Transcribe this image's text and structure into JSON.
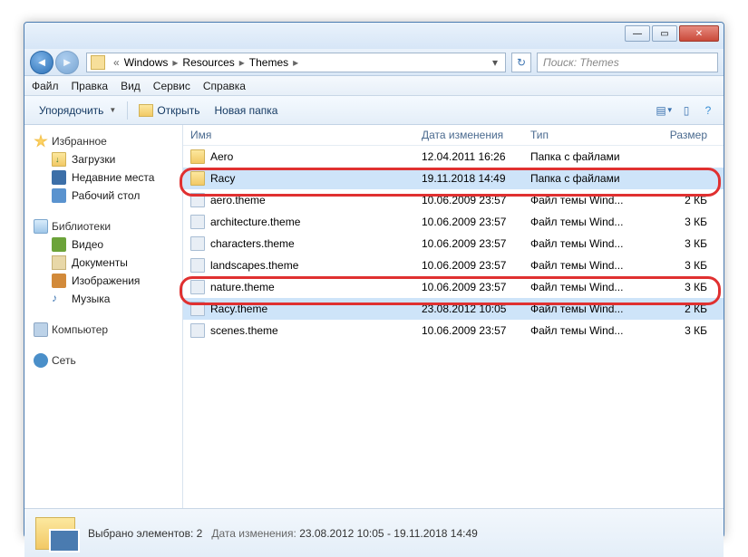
{
  "breadcrumb": [
    "Windows",
    "Resources",
    "Themes"
  ],
  "search_placeholder": "Поиск: Themes",
  "menu": {
    "file": "Файл",
    "edit": "Правка",
    "view": "Вид",
    "tools": "Сервис",
    "help": "Справка"
  },
  "toolbar": {
    "organize": "Упорядочить",
    "open": "Открыть",
    "newfolder": "Новая папка"
  },
  "sidebar": {
    "fav": {
      "head": "Избранное",
      "items": [
        "Загрузки",
        "Недавние места",
        "Рабочий стол"
      ]
    },
    "lib": {
      "head": "Библиотеки",
      "items": [
        "Видео",
        "Документы",
        "Изображения",
        "Музыка"
      ]
    },
    "comp": "Компьютер",
    "net": "Сеть"
  },
  "columns": {
    "name": "Имя",
    "date": "Дата изменения",
    "type": "Тип",
    "size": "Размер"
  },
  "rows": [
    {
      "icon": "folder",
      "name": "Aero",
      "date": "12.04.2011 16:26",
      "type": "Папка с файлами",
      "size": "",
      "sel": false
    },
    {
      "icon": "folder",
      "name": "Racy",
      "date": "19.11.2018 14:49",
      "type": "Папка с файлами",
      "size": "",
      "sel": true
    },
    {
      "icon": "theme",
      "name": "aero.theme",
      "date": "10.06.2009 23:57",
      "type": "Файл темы Wind...",
      "size": "2 КБ",
      "sel": false
    },
    {
      "icon": "theme",
      "name": "architecture.theme",
      "date": "10.06.2009 23:57",
      "type": "Файл темы Wind...",
      "size": "3 КБ",
      "sel": false
    },
    {
      "icon": "theme",
      "name": "characters.theme",
      "date": "10.06.2009 23:57",
      "type": "Файл темы Wind...",
      "size": "3 КБ",
      "sel": false
    },
    {
      "icon": "theme",
      "name": "landscapes.theme",
      "date": "10.06.2009 23:57",
      "type": "Файл темы Wind...",
      "size": "3 КБ",
      "sel": false
    },
    {
      "icon": "theme",
      "name": "nature.theme",
      "date": "10.06.2009 23:57",
      "type": "Файл темы Wind...",
      "size": "3 КБ",
      "sel": false
    },
    {
      "icon": "theme",
      "name": "Racy.theme",
      "date": "23.08.2012 10:05",
      "type": "Файл темы Wind...",
      "size": "2 КБ",
      "sel": true
    },
    {
      "icon": "theme",
      "name": "scenes.theme",
      "date": "10.06.2009 23:57",
      "type": "Файл темы Wind...",
      "size": "3 КБ",
      "sel": false
    }
  ],
  "status": {
    "sel": "Выбрано элементов: 2",
    "date_lbl": "Дата изменения:",
    "date_val": "23.08.2012 10:05 - 19.11.2018 14:49"
  }
}
